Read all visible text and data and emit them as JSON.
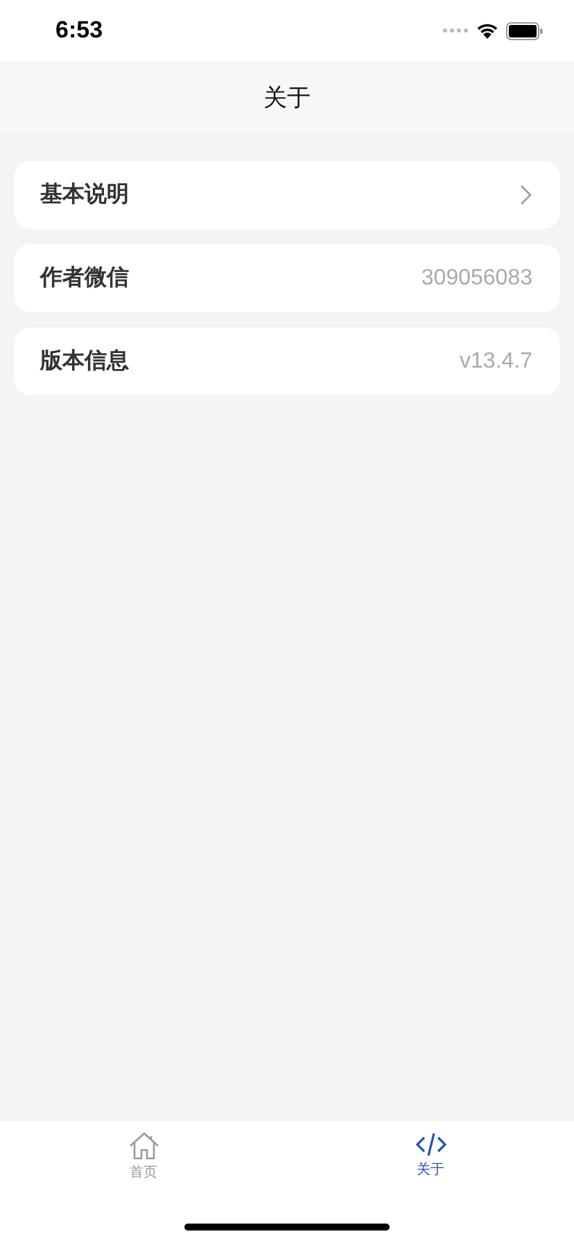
{
  "status_bar": {
    "time": "6:53"
  },
  "nav_bar": {
    "title": "关于"
  },
  "rows": [
    {
      "kind": "link",
      "label": "基本说明"
    },
    {
      "kind": "value",
      "label": "作者微信",
      "value": "309056083"
    },
    {
      "kind": "value",
      "label": "版本信息",
      "value": "v13.4.7"
    }
  ],
  "tab_bar": [
    {
      "kind": "home",
      "label": "首页",
      "selected": false
    },
    {
      "kind": "code",
      "label": "关于",
      "selected": true
    }
  ]
}
